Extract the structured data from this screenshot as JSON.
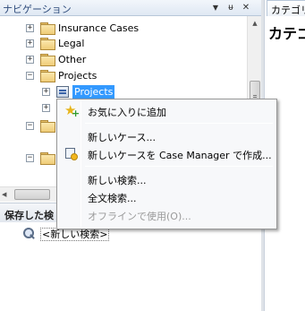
{
  "navigation": {
    "title": "ナビゲーション",
    "dropdown_glyph": "▼",
    "pin_glyph": "ᵾ",
    "close_glyph": "✕",
    "tree": [
      {
        "label": "Insurance Cases",
        "expander": "+"
      },
      {
        "label": "Legal",
        "expander": "+"
      },
      {
        "label": "Other",
        "expander": "+"
      },
      {
        "label": "Projects",
        "expander": "−"
      },
      {
        "label": "Projects",
        "expander": "+",
        "selected": true
      },
      {
        "label": "",
        "expander": "+"
      },
      {
        "label": "",
        "expander": "−"
      },
      {
        "label": "",
        "expander": "−"
      }
    ]
  },
  "saved_searches": {
    "title": "保存した検",
    "item_label": "<新しい検索>"
  },
  "right_pane": {
    "tab_label": "カテゴリ",
    "heading": "カテゴ"
  },
  "context_menu": {
    "items": [
      {
        "label": "お気に入りに追加",
        "icon": "star-add-icon",
        "enabled": true
      },
      {
        "label": "新しいケース...",
        "enabled": true
      },
      {
        "label": "新しいケースを Case Manager で作成...",
        "icon": "case-manager-icon",
        "enabled": true
      },
      {
        "label": "新しい検索...",
        "enabled": true
      },
      {
        "label": "全文検索...",
        "enabled": true
      },
      {
        "label": "オフラインで使用(O)...",
        "enabled": false
      }
    ]
  },
  "colors": {
    "selection": "#3399ff",
    "header_text": "#2d4a7a",
    "disabled_text": "#9a9a9a"
  }
}
